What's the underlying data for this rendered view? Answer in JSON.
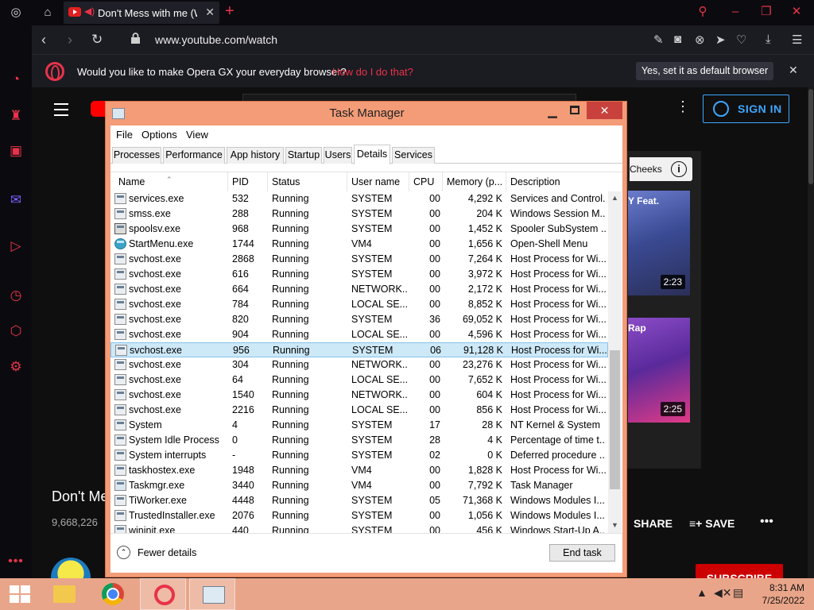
{
  "browser": {
    "tab_title": "Don't Mess with me (W",
    "url": "www.youtube.com/watch",
    "accent_color": "#e8334a"
  },
  "default_bar": {
    "message": "Would you like to make Opera GX your everyday browser?",
    "link": "How do I do that?",
    "button": "Yes, set it as default browser"
  },
  "youtube": {
    "sign_in": "SIGN IN",
    "chip": "Cheeks",
    "thumb1_title": "Y Feat.",
    "thumb1_duration": "2:23",
    "thumb2_title": "Rap",
    "thumb2_duration": "2:25",
    "video_title": "Don't Me",
    "views": "9,668,226",
    "share": "SHARE",
    "save": "SAVE",
    "subscribe": "SUBSCRIBE"
  },
  "task_manager": {
    "title": "Task Manager",
    "menu": [
      "File",
      "Options",
      "View"
    ],
    "tabs": [
      "Processes",
      "Performance",
      "App history",
      "Startup",
      "Users",
      "Details",
      "Services"
    ],
    "active_tab": "Details",
    "columns": [
      "Name",
      "PID",
      "Status",
      "User name",
      "CPU",
      "Memory (p...",
      "Description"
    ],
    "rows": [
      {
        "name": "services.exe",
        "pid": "532",
        "status": "Running",
        "user": "SYSTEM",
        "cpu": "00",
        "memory": "4,292 K",
        "desc": "Services and Control..."
      },
      {
        "name": "smss.exe",
        "pid": "288",
        "status": "Running",
        "user": "SYSTEM",
        "cpu": "00",
        "memory": "204 K",
        "desc": "Windows Session M..."
      },
      {
        "name": "spoolsv.exe",
        "pid": "968",
        "status": "Running",
        "user": "SYSTEM",
        "cpu": "00",
        "memory": "1,452 K",
        "desc": "Spooler SubSystem ..."
      },
      {
        "name": "StartMenu.exe",
        "pid": "1744",
        "status": "Running",
        "user": "VM4",
        "cpu": "00",
        "memory": "1,656 K",
        "desc": "Open-Shell Menu"
      },
      {
        "name": "svchost.exe",
        "pid": "2868",
        "status": "Running",
        "user": "SYSTEM",
        "cpu": "00",
        "memory": "7,264 K",
        "desc": "Host Process for Wi..."
      },
      {
        "name": "svchost.exe",
        "pid": "616",
        "status": "Running",
        "user": "SYSTEM",
        "cpu": "00",
        "memory": "3,972 K",
        "desc": "Host Process for Wi..."
      },
      {
        "name": "svchost.exe",
        "pid": "664",
        "status": "Running",
        "user": "NETWORK...",
        "cpu": "00",
        "memory": "2,172 K",
        "desc": "Host Process for Wi..."
      },
      {
        "name": "svchost.exe",
        "pid": "784",
        "status": "Running",
        "user": "LOCAL SE...",
        "cpu": "00",
        "memory": "8,852 K",
        "desc": "Host Process for Wi..."
      },
      {
        "name": "svchost.exe",
        "pid": "820",
        "status": "Running",
        "user": "SYSTEM",
        "cpu": "36",
        "memory": "69,052 K",
        "desc": "Host Process for Wi..."
      },
      {
        "name": "svchost.exe",
        "pid": "904",
        "status": "Running",
        "user": "LOCAL SE...",
        "cpu": "00",
        "memory": "4,596 K",
        "desc": "Host Process for Wi..."
      },
      {
        "name": "svchost.exe",
        "pid": "956",
        "status": "Running",
        "user": "SYSTEM",
        "cpu": "06",
        "memory": "91,128 K",
        "desc": "Host Process for Wi..."
      },
      {
        "name": "svchost.exe",
        "pid": "304",
        "status": "Running",
        "user": "NETWORK...",
        "cpu": "00",
        "memory": "23,276 K",
        "desc": "Host Process for Wi..."
      },
      {
        "name": "svchost.exe",
        "pid": "64",
        "status": "Running",
        "user": "LOCAL SE...",
        "cpu": "00",
        "memory": "7,652 K",
        "desc": "Host Process for Wi..."
      },
      {
        "name": "svchost.exe",
        "pid": "1540",
        "status": "Running",
        "user": "NETWORK...",
        "cpu": "00",
        "memory": "604 K",
        "desc": "Host Process for Wi..."
      },
      {
        "name": "svchost.exe",
        "pid": "2216",
        "status": "Running",
        "user": "LOCAL SE...",
        "cpu": "00",
        "memory": "856 K",
        "desc": "Host Process for Wi..."
      },
      {
        "name": "System",
        "pid": "4",
        "status": "Running",
        "user": "SYSTEM",
        "cpu": "17",
        "memory": "28 K",
        "desc": "NT Kernel & System"
      },
      {
        "name": "System Idle Process",
        "pid": "0",
        "status": "Running",
        "user": "SYSTEM",
        "cpu": "28",
        "memory": "4 K",
        "desc": "Percentage of time t..."
      },
      {
        "name": "System interrupts",
        "pid": "-",
        "status": "Running",
        "user": "SYSTEM",
        "cpu": "02",
        "memory": "0 K",
        "desc": "Deferred procedure ..."
      },
      {
        "name": "taskhostex.exe",
        "pid": "1948",
        "status": "Running",
        "user": "VM4",
        "cpu": "00",
        "memory": "1,828 K",
        "desc": "Host Process for Wi..."
      },
      {
        "name": "Taskmgr.exe",
        "pid": "3440",
        "status": "Running",
        "user": "VM4",
        "cpu": "00",
        "memory": "7,792 K",
        "desc": "Task Manager"
      },
      {
        "name": "TiWorker.exe",
        "pid": "4448",
        "status": "Running",
        "user": "SYSTEM",
        "cpu": "05",
        "memory": "71,368 K",
        "desc": "Windows Modules I..."
      },
      {
        "name": "TrustedInstaller.exe",
        "pid": "2076",
        "status": "Running",
        "user": "SYSTEM",
        "cpu": "00",
        "memory": "1,056 K",
        "desc": "Windows Modules I..."
      },
      {
        "name": "wininit.exe",
        "pid": "440",
        "status": "Running",
        "user": "SYSTEM",
        "cpu": "00",
        "memory": "456 K",
        "desc": "Windows Start-Up A..."
      }
    ],
    "selected_pid": "956",
    "fewer_details": "Fewer details",
    "end_task": "End task",
    "window_color": "#f39c77"
  },
  "taskbar": {
    "time": "8:31 AM",
    "date": "7/25/2022",
    "color": "#e9a589"
  }
}
